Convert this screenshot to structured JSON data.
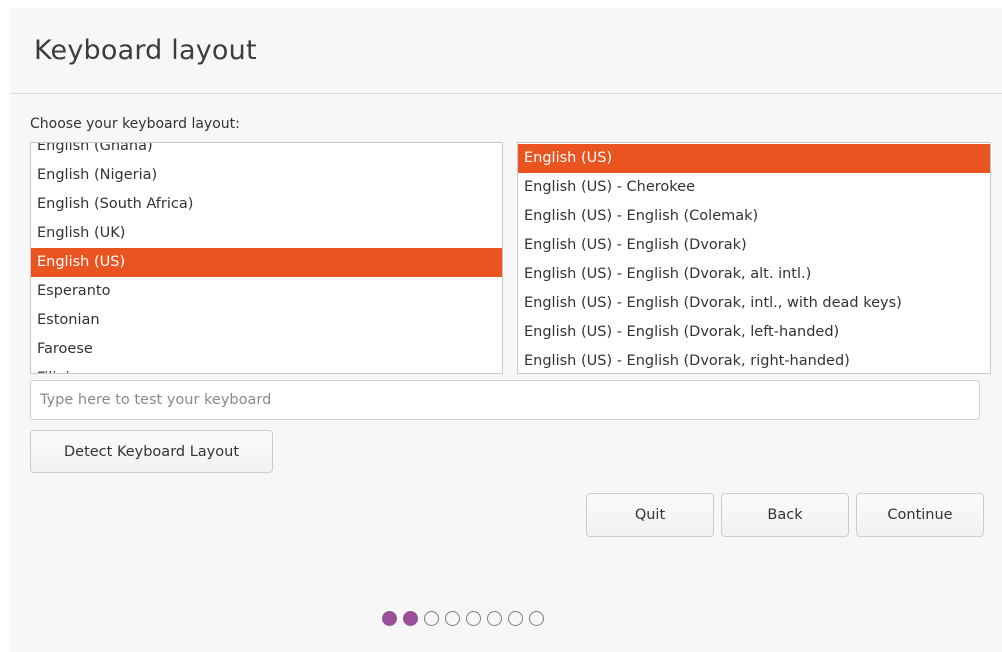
{
  "header": {
    "title": "Keyboard layout"
  },
  "layout_label": "Choose your keyboard layout:",
  "languages": [
    {
      "label": "English (Ghana)",
      "selected": false
    },
    {
      "label": "English (Nigeria)",
      "selected": false
    },
    {
      "label": "English (South Africa)",
      "selected": false
    },
    {
      "label": "English (UK)",
      "selected": false
    },
    {
      "label": "English (US)",
      "selected": true
    },
    {
      "label": "Esperanto",
      "selected": false
    },
    {
      "label": "Estonian",
      "selected": false
    },
    {
      "label": "Faroese",
      "selected": false
    },
    {
      "label": "Filipino",
      "selected": false
    }
  ],
  "variants": [
    {
      "label": "English (US)",
      "selected": true
    },
    {
      "label": "English (US) - Cherokee",
      "selected": false
    },
    {
      "label": "English (US) - English (Colemak)",
      "selected": false
    },
    {
      "label": "English (US) - English (Dvorak)",
      "selected": false
    },
    {
      "label": "English (US) - English (Dvorak, alt. intl.)",
      "selected": false
    },
    {
      "label": "English (US) - English (Dvorak, intl., with dead keys)",
      "selected": false
    },
    {
      "label": "English (US) - English (Dvorak, left-handed)",
      "selected": false
    },
    {
      "label": "English (US) - English (Dvorak, right-handed)",
      "selected": false
    }
  ],
  "test_input": {
    "placeholder": "Type here to test your keyboard",
    "value": ""
  },
  "buttons": {
    "detect": "Detect Keyboard Layout",
    "quit": "Quit",
    "back": "Back",
    "continue": "Continue"
  },
  "progress": {
    "total_steps": 8,
    "completed_steps": 2
  },
  "colors": {
    "selection": "#e95420",
    "progress_active": "#9b4f96"
  }
}
